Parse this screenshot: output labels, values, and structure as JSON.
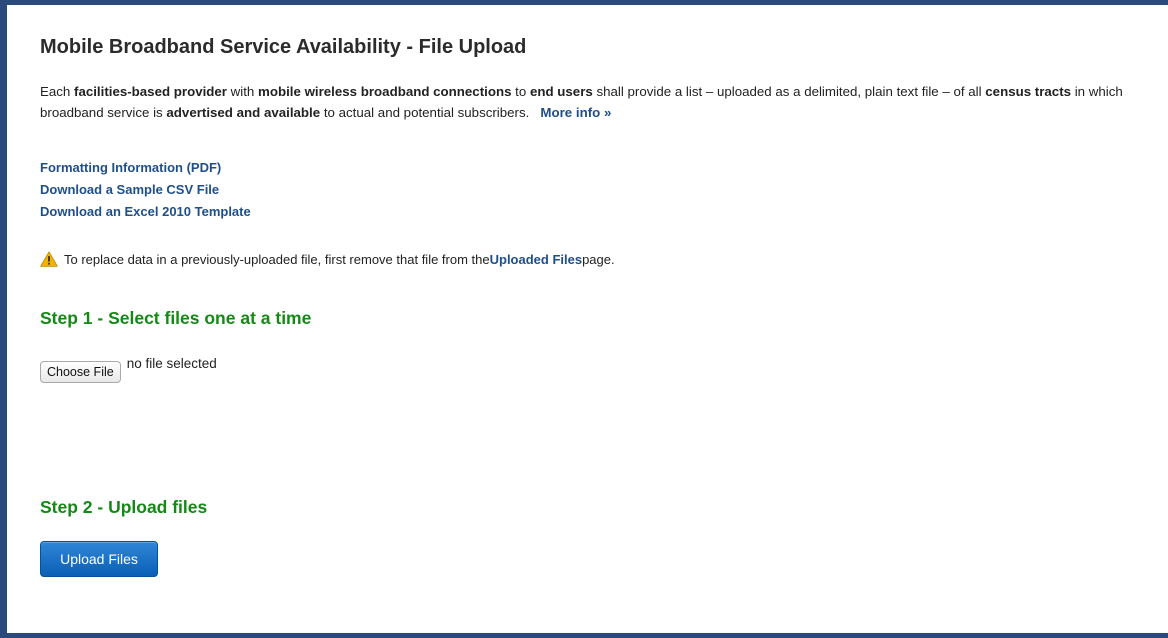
{
  "page": {
    "title": "Mobile Broadband Service Availability - File Upload"
  },
  "intro": {
    "t1": "Each ",
    "b1": "facilities-based provider",
    "t2": " with ",
    "b2": "mobile wireless broadband connections",
    "t3": " to ",
    "b3": "end users",
    "t4": " shall provide a list – uploaded as a delimited, plain text file – of all ",
    "b4": "census tracts",
    "t5": " in which broadband service is ",
    "b5": "advertised and available",
    "t6": " to actual and potential subscribers.",
    "more_info": "More info »"
  },
  "links": {
    "formatting": "Formatting Information (PDF)",
    "sample_csv": "Download a Sample CSV File",
    "excel_template": "Download an Excel 2010 Template"
  },
  "notice": {
    "icon": "warning-icon",
    "t1": "To replace data in a previously-uploaded file, first remove that file from the ",
    "link": "Uploaded Files",
    "t2": " page."
  },
  "step1": {
    "heading": "Step 1 - Select files one at a time",
    "choose_label": "Choose File",
    "file_status": "no file selected"
  },
  "step2": {
    "heading": "Step 2 - Upload files",
    "upload_label": "Upload Files"
  },
  "colors": {
    "frame_border": "#2a4a7b",
    "link": "#1f4f8a",
    "step_heading": "#138a13",
    "upload_button": "#0b5fb5",
    "warning": "#f0b400"
  }
}
